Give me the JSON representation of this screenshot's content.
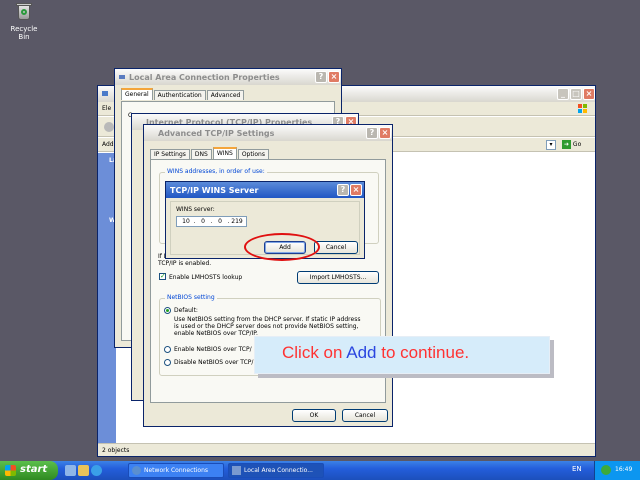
{
  "desktop": {
    "recycle_bin_label": "Recycle Bin"
  },
  "explorer": {
    "menu_fragment": "Ele",
    "address_fragment": "Add",
    "go_label": "Go",
    "status": "2 objects",
    "side_fragments": [
      "La",
      "W"
    ]
  },
  "lac_props": {
    "title": "Local Area Connection Properties",
    "tabs": [
      "General",
      "Authentication",
      "Advanced"
    ],
    "body_fragment": "Co"
  },
  "tcpip_props": {
    "title": "Internet Protocol (TCP/IP) Properties"
  },
  "advanced": {
    "title": "Advanced TCP/IP Settings",
    "tabs": [
      "IP Settings",
      "DNS",
      "WINS",
      "Options"
    ],
    "wins_group_label": "WINS addresses, in order of use:",
    "lmhosts_note": "If LMHOSTS lookup is enabled, it applies to all connections for which TCP/IP is enabled.",
    "lmhosts_note_line1": "If L",
    "lmhosts_note_line2": "TCP/IP is enabled.",
    "enable_lmhosts_label": "Enable LMHOSTS lookup",
    "import_label": "Import LMHOSTS...",
    "netbios_group_label": "NetBIOS setting",
    "default_label": "Default:",
    "default_desc_lines": [
      "Use NetBIOS setting from the DHCP server. If static IP address",
      "is used or the DHCP server does not provide NetBIOS setting,",
      "enable NetBIOS over TCP/IP."
    ],
    "enable_netbios_label": "Enable NetBIOS over TCP/",
    "disable_netbios_label": "Disable NetBIOS over TCP/",
    "ok_label": "OK",
    "cancel_label": "Cancel"
  },
  "wins_dialog": {
    "title": "TCP/IP WINS Server",
    "server_label": "WINS server:",
    "ip_octets": [
      "10",
      "0",
      "0",
      "219"
    ],
    "add_label": "Add",
    "cancel_label": "Cancel"
  },
  "callout": {
    "part1": "Click on ",
    "highlight": "Add",
    "part2": " to continue."
  },
  "taskbar": {
    "start_label": "start",
    "tasks": [
      "Network Connections",
      "Local Area Connectio..."
    ],
    "language": "EN",
    "clock": "16:49"
  },
  "colors": {
    "accent": "#2157c4",
    "highlight_ring": "#e01010",
    "callout_bg": "#d6ecfa"
  }
}
